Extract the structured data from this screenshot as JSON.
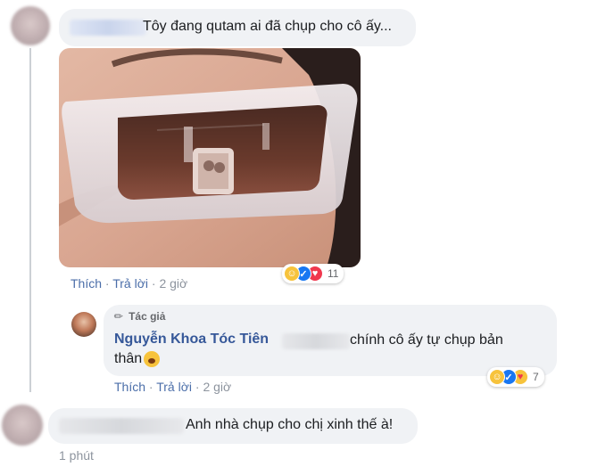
{
  "comment1": {
    "text": "Tôy đang qutam ai đã chụp cho cô ấy...",
    "like_label": "Thích",
    "reply_label": "Trả lời",
    "time": "2 giờ",
    "reaction_count": "11",
    "reaction_icons": [
      "haha-icon",
      "like-icon",
      "love-icon"
    ]
  },
  "reply1": {
    "badge_label": "Tác giả",
    "author": "Nguyễn Khoa Tóc Tiên",
    "text_line1": "chính cô ấy tự chụp bản",
    "text_line2": "thân",
    "like_label": "Thích",
    "reply_label": "Trả lời",
    "time": "2 giờ",
    "reaction_count": "7",
    "reaction_icons": [
      "haha-icon",
      "like-icon",
      "care-icon"
    ]
  },
  "comment2": {
    "text": "Anh nhà chụp cho chị xinh thế à!",
    "time": "1 phút"
  },
  "separator": "·",
  "colors": {
    "link_blue": "#4b6ea9",
    "bubble_bg": "#f0f2f5",
    "muted_text": "#8d949e"
  }
}
